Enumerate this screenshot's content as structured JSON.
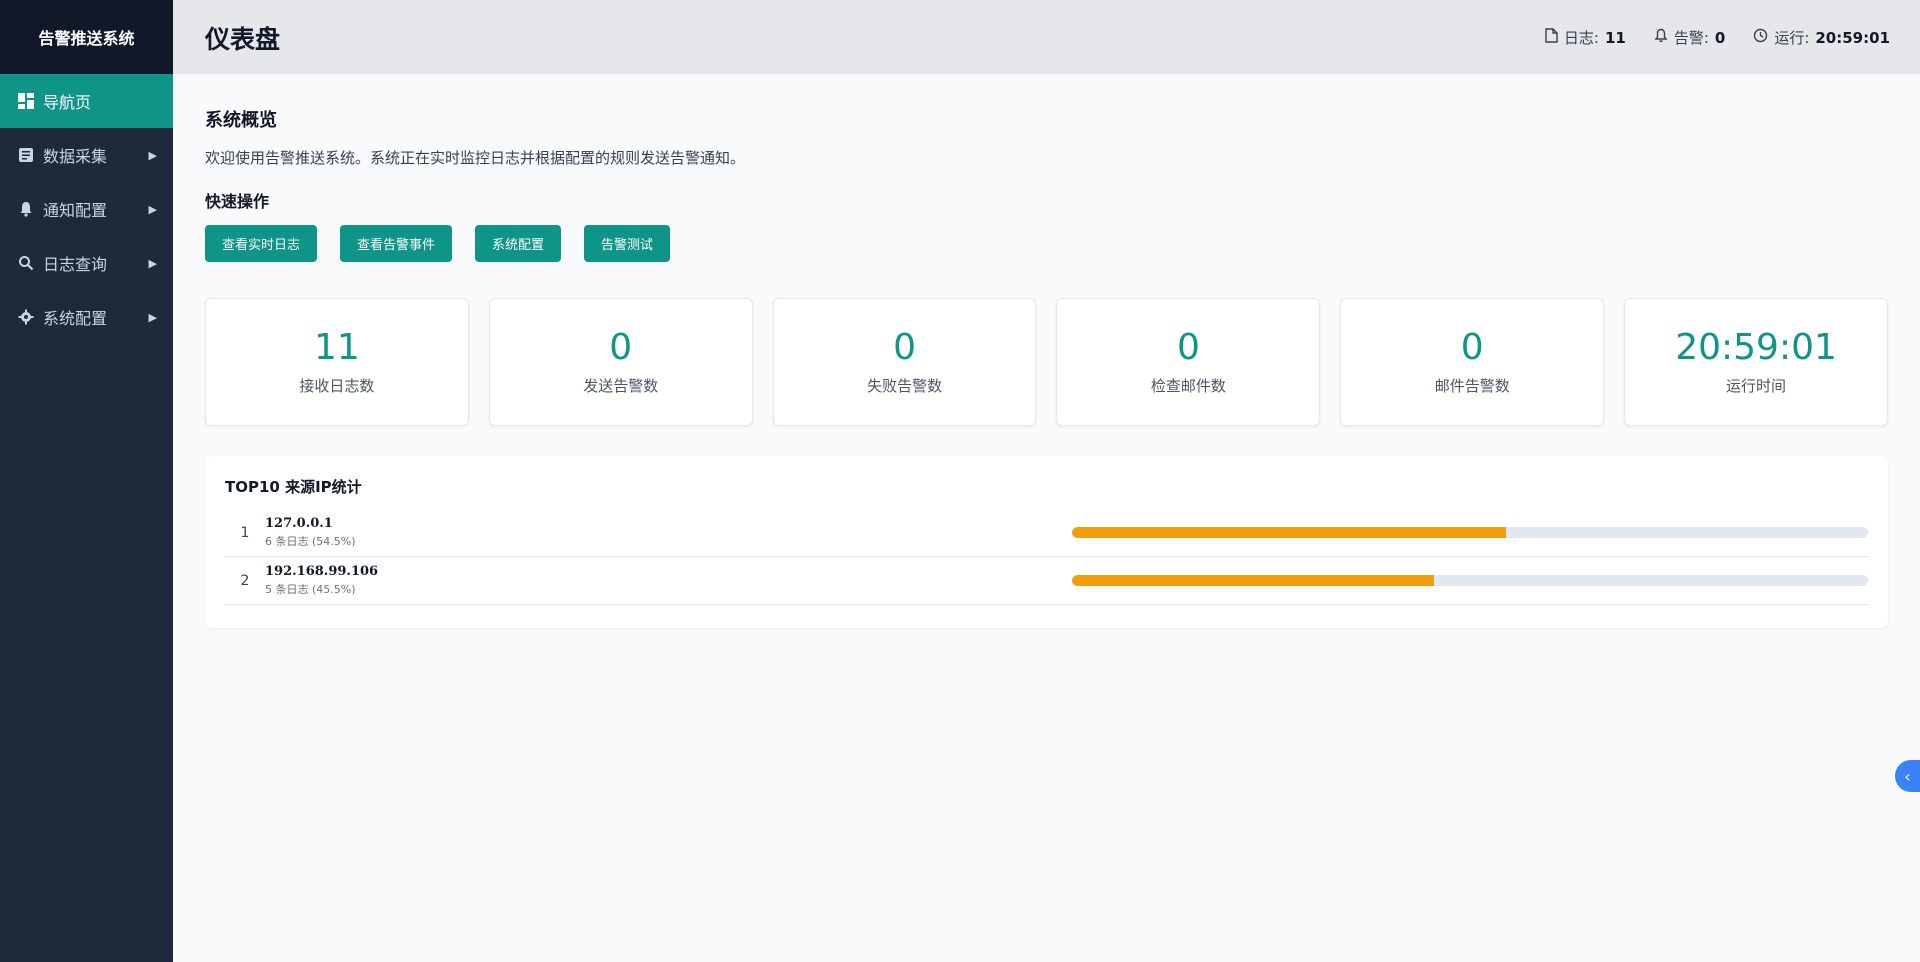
{
  "app": {
    "title": "告警推送系统"
  },
  "sidebar": {
    "items": [
      {
        "label": "导航页",
        "icon": "dashboard-icon",
        "active": true
      },
      {
        "label": "数据采集",
        "icon": "document-icon"
      },
      {
        "label": "通知配置",
        "icon": "bell-icon"
      },
      {
        "label": "日志查询",
        "icon": "search-icon"
      },
      {
        "label": "系统配置",
        "icon": "gear-icon"
      }
    ]
  },
  "header": {
    "title": "仪表盘",
    "status": {
      "logs_label": "日志:",
      "logs_value": "11",
      "alerts_label": "告警:",
      "alerts_value": "0",
      "uptime_label": "运行:",
      "uptime_value": "20:59:01"
    }
  },
  "overview": {
    "title": "系统概览",
    "welcome": "欢迎使用告警推送系统。系统正在实时监控日志并根据配置的规则发送告警通知。",
    "quick_title": "快速操作",
    "actions": [
      "查看实时日志",
      "查看告警事件",
      "系统配置",
      "告警测试"
    ]
  },
  "stats": [
    {
      "value": "11",
      "label": "接收日志数"
    },
    {
      "value": "0",
      "label": "发送告警数"
    },
    {
      "value": "0",
      "label": "失败告警数"
    },
    {
      "value": "0",
      "label": "检查邮件数"
    },
    {
      "value": "0",
      "label": "邮件告警数"
    },
    {
      "value": "20:59:01",
      "label": "运行时间"
    }
  ],
  "top_ip": {
    "title": "TOP10 来源IP统计",
    "rows": [
      {
        "rank": "1",
        "ip": "127.0.0.1",
        "count": "6 条日志 (54.5%)",
        "percent": 54.5
      },
      {
        "rank": "2",
        "ip": "192.168.99.106",
        "count": "5 条日志 (45.5%)",
        "percent": 45.5
      }
    ]
  },
  "colors": {
    "accent": "#0f9488",
    "sidebar_bg": "#1e293b",
    "bar_fill": "#f59e0b"
  }
}
